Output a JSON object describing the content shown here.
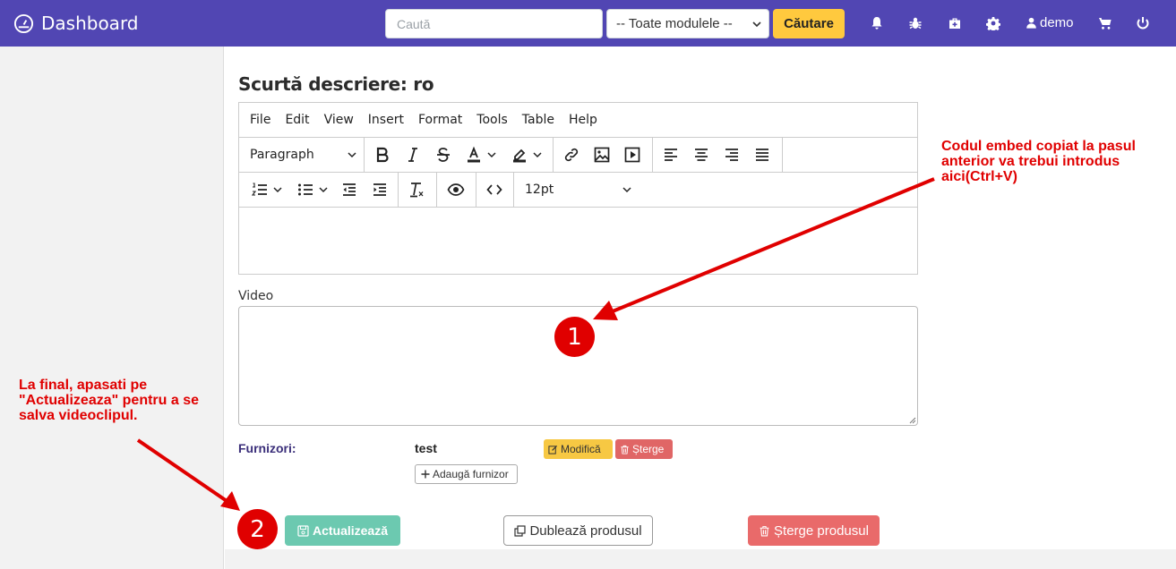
{
  "header": {
    "brand": "Dashboard",
    "search_placeholder": "Caută",
    "module_select": "-- Toate modulele --",
    "search_button": "Căutare",
    "user": "demo",
    "background": "#5146b3",
    "icons": [
      "bell-icon",
      "bug-icon",
      "medkit-icon",
      "gear-icon",
      "user-icon",
      "cart-icon",
      "power-icon"
    ]
  },
  "section": {
    "title": "Scurtă descriere: ro"
  },
  "editor": {
    "menu": [
      "File",
      "Edit",
      "View",
      "Insert",
      "Format",
      "Tools",
      "Table",
      "Help"
    ],
    "block_format": "Paragraph",
    "font_size": "12pt"
  },
  "video": {
    "label": "Video",
    "value": ""
  },
  "suppliers": {
    "label": "Furnizori:",
    "name": "test",
    "modify": "Modifică",
    "delete": "Șterge",
    "add": "Adaugă furnizor"
  },
  "actions": {
    "update": "Actualizează",
    "duplicate": "Dublează produsul",
    "delete_product": "Șterge produsul"
  },
  "annotations": {
    "note_1": "Codul embed copiat la pasul anterior va trebui introdus aici(Ctrl+V)",
    "note_2": "La final, apasati pe \"Actualizeaza\" pentru a se salva videoclipul.",
    "badge_1": "1",
    "badge_2": "2",
    "color": "#e00000"
  }
}
